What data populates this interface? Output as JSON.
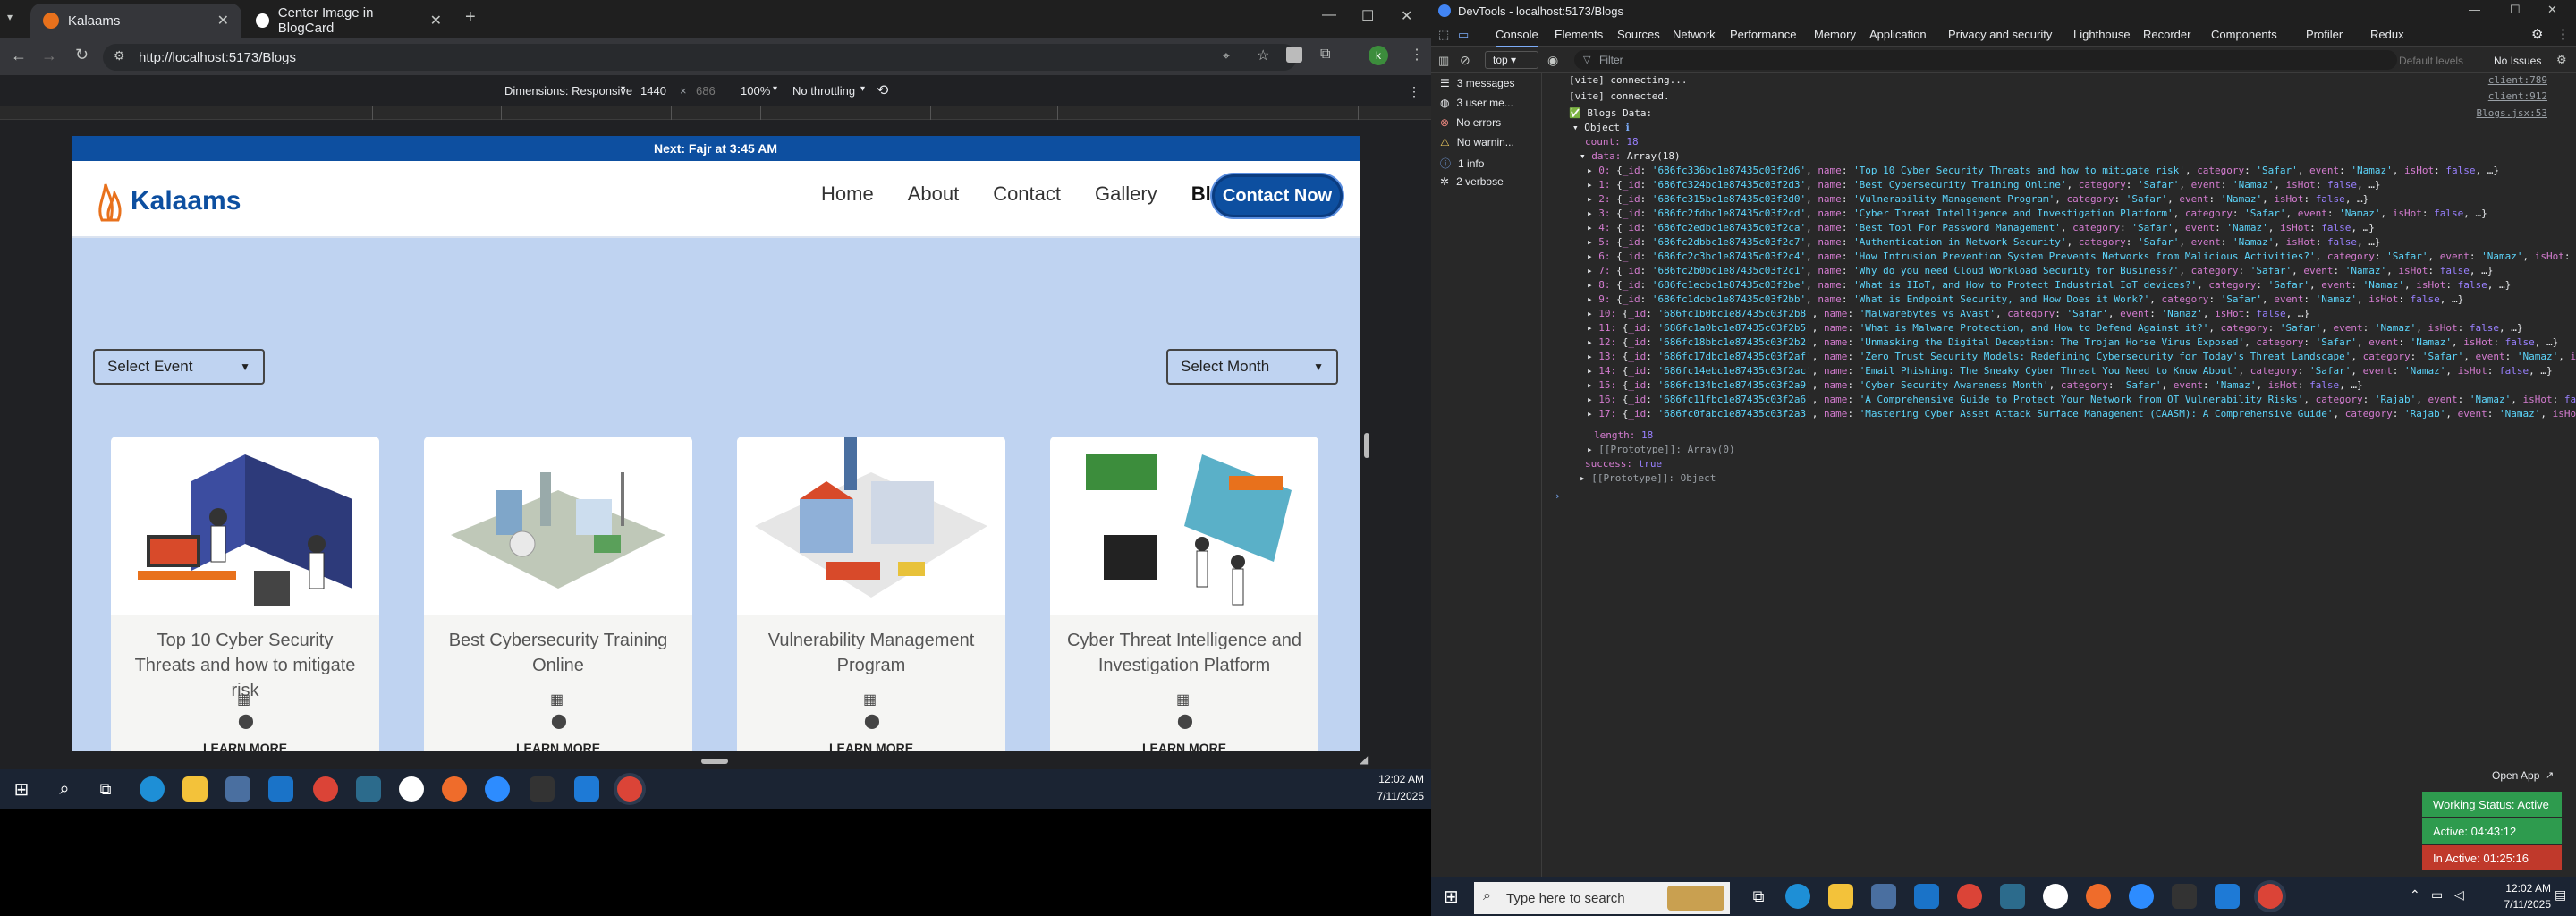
{
  "browser": {
    "tabs": [
      {
        "title": "Kalaams",
        "active": true
      },
      {
        "title": "Center Image in BlogCard",
        "active": false
      }
    ],
    "url": "http://localhost:5173/Blogs"
  },
  "device_toolbar": {
    "dimensions_label": "Dimensions: Responsive",
    "width": "1440",
    "height": "686",
    "zoom": "100%",
    "throttle": "No throttling"
  },
  "site": {
    "notice": "Next: Fajr at 3:45 AM",
    "logo_text": "Kalaams",
    "nav": [
      "Home",
      "About",
      "Contact",
      "Gallery",
      "Blogs"
    ],
    "contact_button": "Contact Now",
    "select_event": "Select Event",
    "select_month": "Select Month",
    "cards": [
      {
        "title": "Top 10 Cyber Security Threats and how to mitigate risk"
      },
      {
        "title": "Best Cybersecurity Training Online"
      },
      {
        "title": "Vulnerability Management Program"
      },
      {
        "title": "Cyber Threat Intelligence and Investigation Platform"
      }
    ],
    "learn_more": "LEARN MORE"
  },
  "left_clock": {
    "time": "12:02 AM",
    "date": "7/11/2025"
  },
  "devtools": {
    "title": "DevTools - localhost:5173/Blogs",
    "tabs": [
      "Console",
      "Elements",
      "Sources",
      "Network",
      "Performance",
      "Memory",
      "Application",
      "Privacy and security",
      "Lighthouse",
      "Recorder",
      "Components",
      "Profiler",
      "Redux"
    ],
    "context": "top",
    "filter_placeholder": "Filter",
    "levels": "Default levels",
    "issues": "No Issues",
    "sidebar": [
      "3 messages",
      "3 user me...",
      "No errors",
      "No warnin...",
      "1 info",
      "2 verbose"
    ],
    "console": {
      "vite1": "[vite] connecting...",
      "vite1_src": "client:789",
      "vite2": "[vite] connected.",
      "vite2_src": "client:912",
      "blogs_label": "Blogs Data:",
      "blogs_src": "Blogs.jsx:53",
      "object": "Object",
      "count_key": "count:",
      "count_val": "18",
      "data_key": "data:",
      "data_val": "Array(18)",
      "rows": [
        {
          "i": "0:",
          "id": "'686fc336bc1e87435c03f2d6'",
          "name": "'Top 10 Cyber Security Threats and how to mitigate risk'",
          "cat": "'Safar'",
          "ev": "'Namaz'"
        },
        {
          "i": "1:",
          "id": "'686fc324bc1e87435c03f2d3'",
          "name": "'Best Cybersecurity Training Online'",
          "cat": "'Safar'",
          "ev": "'Namaz'"
        },
        {
          "i": "2:",
          "id": "'686fc315bc1e87435c03f2d0'",
          "name": "'Vulnerability Management Program'",
          "cat": "'Safar'",
          "ev": "'Namaz'"
        },
        {
          "i": "3:",
          "id": "'686fc2fdbc1e87435c03f2cd'",
          "name": "'Cyber Threat Intelligence and Investigation Platform'",
          "cat": "'Safar'",
          "ev": "'Namaz'"
        },
        {
          "i": "4:",
          "id": "'686fc2edbc1e87435c03f2ca'",
          "name": "'Best Tool For Password Management'",
          "cat": "'Safar'",
          "ev": "'Namaz'"
        },
        {
          "i": "5:",
          "id": "'686fc2dbbc1e87435c03f2c7'",
          "name": "'Authentication in Network Security'",
          "cat": "'Safar'",
          "ev": "'Namaz'"
        },
        {
          "i": "6:",
          "id": "'686fc2c3bc1e87435c03f2c4'",
          "name": "'How Intrusion Prevention System Prevents Networks from Malicious Activities?'",
          "cat": "'Safar'",
          "ev": "'Namaz'"
        },
        {
          "i": "7:",
          "id": "'686fc2b0bc1e87435c03f2c1'",
          "name": "'Why do you need Cloud Workload Security for Business?'",
          "cat": "'Safar'",
          "ev": "'Namaz'"
        },
        {
          "i": "8:",
          "id": "'686fc1ecbc1e87435c03f2be'",
          "name": "'What is IIoT, and How to Protect Industrial IoT devices?'",
          "cat": "'Safar'",
          "ev": "'Namaz'"
        },
        {
          "i": "9:",
          "id": "'686fc1dcbc1e87435c03f2bb'",
          "name": "'What is Endpoint Security, and How Does it Work?'",
          "cat": "'Safar'",
          "ev": "'Namaz'"
        },
        {
          "i": "10:",
          "id": "'686fc1b0bc1e87435c03f2b8'",
          "name": "'Malwarebytes vs Avast'",
          "cat": "'Safar'",
          "ev": "'Namaz'"
        },
        {
          "i": "11:",
          "id": "'686fc1a0bc1e87435c03f2b5'",
          "name": "'What is Malware Protection, and How to Defend Against it?'",
          "cat": "'Safar'",
          "ev": "'Namaz'"
        },
        {
          "i": "12:",
          "id": "'686fc18bbc1e87435c03f2b2'",
          "name": "'Unmasking the Digital Deception: The Trojan Horse Virus Exposed'",
          "cat": "'Safar'",
          "ev": "'Namaz'"
        },
        {
          "i": "13:",
          "id": "'686fc17dbc1e87435c03f2af'",
          "name": "'Zero Trust Security Models: Redefining Cybersecurity for Today's Threat Landscape'",
          "cat": "'Safar'",
          "ev": "'Namaz'"
        },
        {
          "i": "14:",
          "id": "'686fc14ebc1e87435c03f2ac'",
          "name": "'Email Phishing: The Sneaky Cyber Threat You Need to Know About'",
          "cat": "'Safar'",
          "ev": "'Namaz'"
        },
        {
          "i": "15:",
          "id": "'686fc134bc1e87435c03f2a9'",
          "name": "'Cyber Security Awareness Month'",
          "cat": "'Safar'",
          "ev": "'Namaz'"
        },
        {
          "i": "16:",
          "id": "'686fc11fbc1e87435c03f2a6'",
          "name": "'A Comprehensive Guide to Protect Your Network from OT Vulnerability Risks'",
          "cat": "'Rajab'",
          "ev": "'Namaz'"
        },
        {
          "i": "17:",
          "id": "'686fc0fabc1e87435c03f2a3'",
          "name": "'Mastering Cyber Asset Attack Surface Management (CAASM): A Comprehensive Guide'",
          "cat": "'Rajab'",
          "ev": "'Namaz'"
        }
      ],
      "length_key": "length:",
      "length_val": "18",
      "proto_arr": "[[Prototype]]: Array(0)",
      "success_key": "success:",
      "success_val": "true",
      "proto_obj": "[[Prototype]]: Object"
    }
  },
  "tracker": {
    "open_app": "Open App",
    "working": "Working Status: Active",
    "active": "Active: 04:43:12",
    "inactive": "In Active: 01:25:16"
  },
  "right_taskbar": {
    "search_placeholder": "Type here to search",
    "time": "12:02 AM",
    "date": "7/11/2025"
  },
  "colors": {
    "brand": "#0d4fa0",
    "page_bg": "#bfd3f1",
    "active_green": "#2e9b4e",
    "inactive_red": "#c0392b"
  }
}
